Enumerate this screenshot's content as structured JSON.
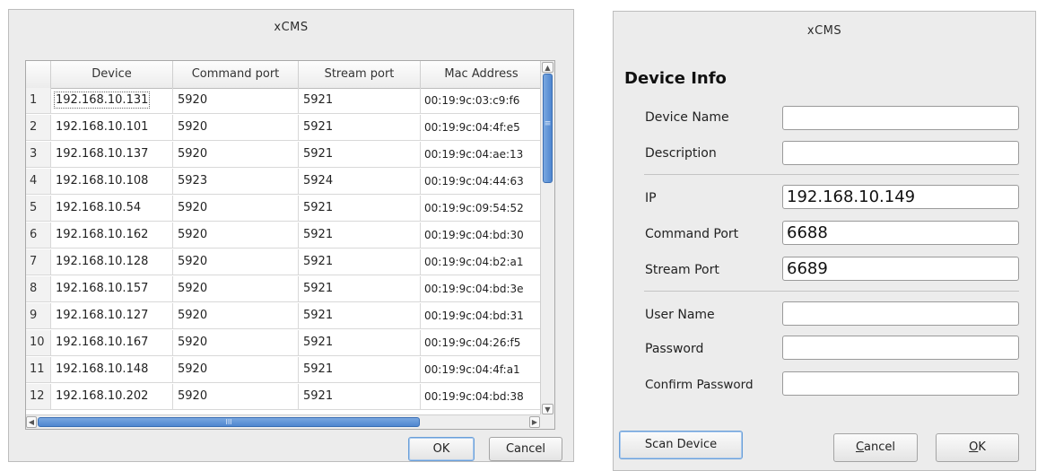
{
  "left_dialog": {
    "title": "xCMS",
    "columns": [
      "Device",
      "Command port",
      "Stream port",
      "Mac Address"
    ],
    "rows": [
      [
        "1",
        "192.168.10.131",
        "5920",
        "5921",
        "00:19:9c:03:c9:f6"
      ],
      [
        "2",
        "192.168.10.101",
        "5920",
        "5921",
        "00:19:9c:04:4f:e5"
      ],
      [
        "3",
        "192.168.10.137",
        "5920",
        "5921",
        "00:19:9c:04:ae:13"
      ],
      [
        "4",
        "192.168.10.108",
        "5923",
        "5924",
        "00:19:9c:04:44:63"
      ],
      [
        "5",
        "192.168.10.54",
        "5920",
        "5921",
        "00:19:9c:09:54:52"
      ],
      [
        "6",
        "192.168.10.162",
        "5920",
        "5921",
        "00:19:9c:04:bd:30"
      ],
      [
        "7",
        "192.168.10.128",
        "5920",
        "5921",
        "00:19:9c:04:b2:a1"
      ],
      [
        "8",
        "192.168.10.157",
        "5920",
        "5921",
        "00:19:9c:04:bd:3e"
      ],
      [
        "9",
        "192.168.10.127",
        "5920",
        "5921",
        "00:19:9c:04:bd:31"
      ],
      [
        "10",
        "192.168.10.167",
        "5920",
        "5921",
        "00:19:9c:04:26:f5"
      ],
      [
        "11",
        "192.168.10.148",
        "5920",
        "5921",
        "00:19:9c:04:4f:a1"
      ],
      [
        "12",
        "192.168.10.202",
        "5920",
        "5921",
        "00:19:9c:04:bd:38"
      ]
    ],
    "ok_label": "OK",
    "cancel_label": "Cancel",
    "scroll_glyphs": {
      "up": "▲",
      "down": "▼",
      "left": "◀",
      "right": "▶",
      "v_grip": "≡",
      "h_grip": "III"
    }
  },
  "right_dialog": {
    "title": "xCMS",
    "section_title": "Device Info",
    "fields": {
      "device_name": {
        "label": "Device Name",
        "value": ""
      },
      "description": {
        "label": "Description",
        "value": ""
      },
      "ip": {
        "label": "IP",
        "value": "192.168.10.149"
      },
      "command_port": {
        "label": "Command Port",
        "value": "6688"
      },
      "stream_port": {
        "label": "Stream Port",
        "value": "6689"
      },
      "user_name": {
        "label": "User Name",
        "value": ""
      },
      "password": {
        "label": "Password",
        "value": ""
      },
      "confirm_password": {
        "label": "Confirm Password",
        "value": ""
      }
    },
    "scan_label": "Scan Device",
    "cancel_label": "Cancel",
    "ok_label": "OK",
    "cancel_mnemonic": "C",
    "cancel_rest": "ancel",
    "ok_mnemonic": "O",
    "ok_rest": "K"
  },
  "colors": {
    "dialog_bg": "#ececec",
    "scroll_thumb": "#4f86cf",
    "default_button_border": "#6a9fd8"
  }
}
